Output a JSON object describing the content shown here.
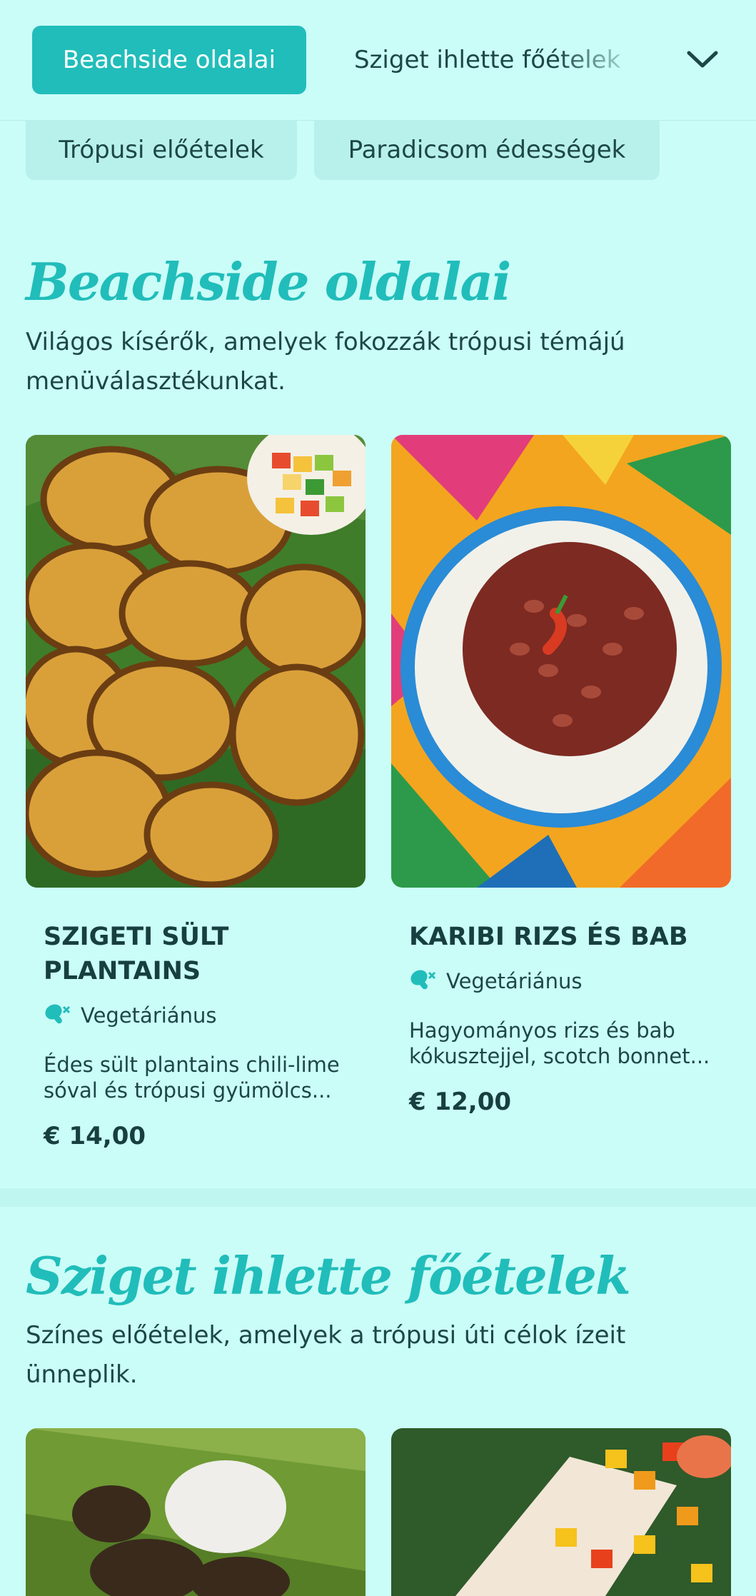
{
  "nav": {
    "active_tab": "Beachside oldalai",
    "second_tab": "Sziget ihlette főételek",
    "row2_tabs": [
      "Trópusi előételek",
      "Paradicsom édességek"
    ]
  },
  "sections": [
    {
      "title": "Beachside oldalai",
      "description": "Világos kísérők, amelyek fokozzák trópusi témájú menüválasztékunkat.",
      "items": [
        {
          "name": "SZIGETI SÜLT PLANTAINS",
          "tag": "Vegetáriánus",
          "description": "Édes sült plantains chili-lime sóval és trópusi gyümölcs...",
          "price": "€ 14,00"
        },
        {
          "name": "KARIBI RIZS ÉS BAB",
          "tag": "Vegetáriánus",
          "description": "Hagyományos rizs és bab kókusztejjel, scotch bonnet...",
          "price": "€ 12,00"
        }
      ]
    },
    {
      "title": "Sziget ihlette főételek",
      "description": "Színes előételek, amelyek a trópusi úti célok ízeit ünneplik."
    }
  ],
  "colors": {
    "accent": "#21bdba",
    "background": "#cafdf8",
    "text": "#173f3f"
  },
  "icons": {
    "tag": "drumstick-no-meat-icon",
    "nav_toggle": "chevron-down-icon"
  }
}
